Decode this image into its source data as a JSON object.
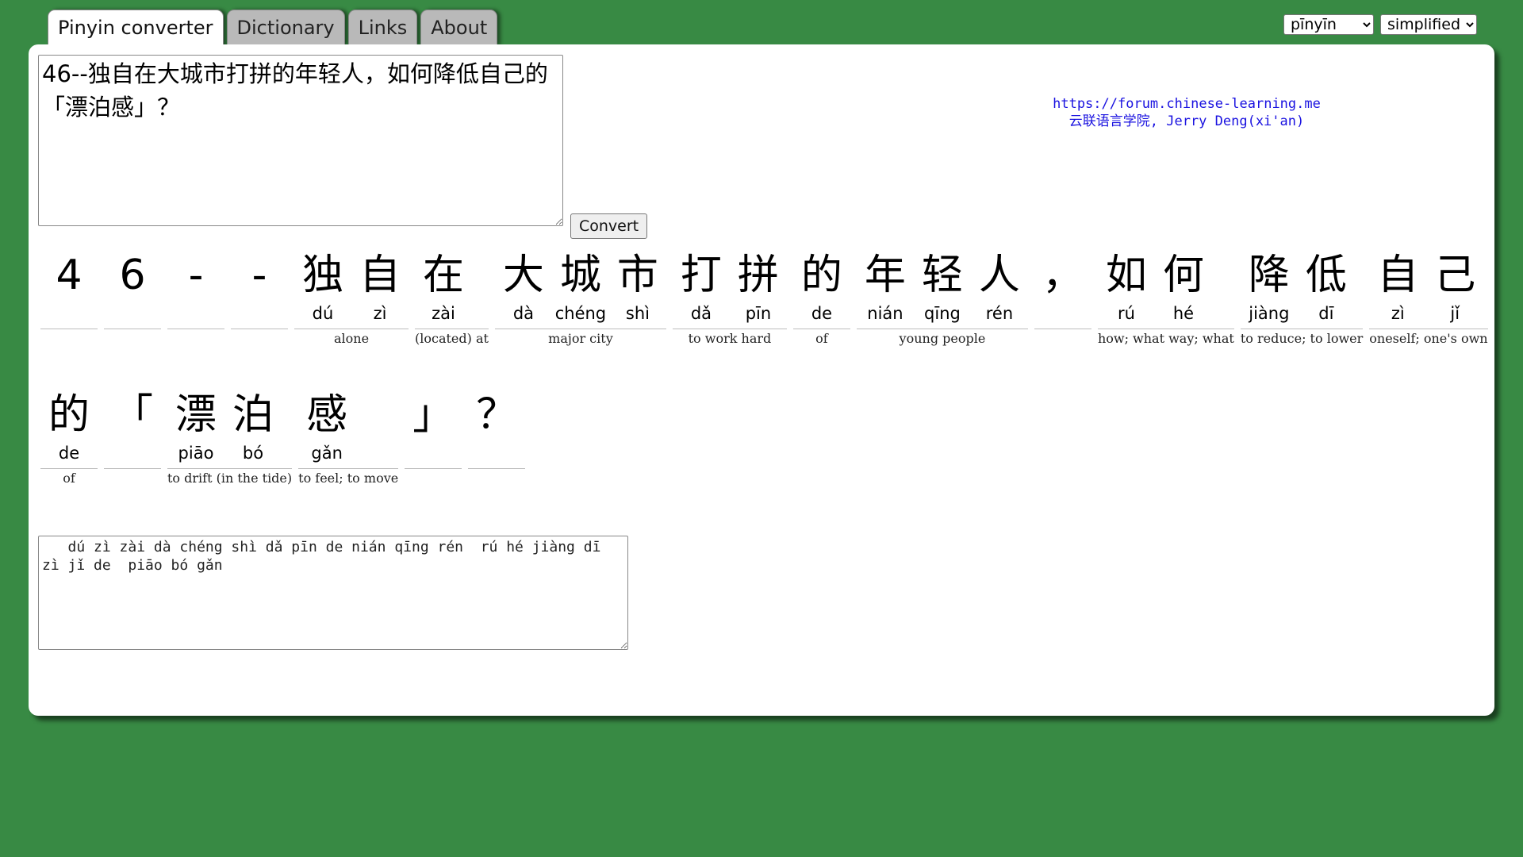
{
  "tabs": [
    {
      "label": "Pinyin converter",
      "active": true
    },
    {
      "label": "Dictionary",
      "active": false
    },
    {
      "label": "Links",
      "active": false
    },
    {
      "label": "About",
      "active": false
    }
  ],
  "selectors": {
    "romanization": "pīnyīn",
    "charset": "simplified"
  },
  "input": {
    "value": "46--独自在大城市打拼的年轻人，如何降低自己的「漂泊感」？"
  },
  "convert_label": "Convert",
  "credits": {
    "url": "https://forum.chinese-learning.me",
    "author": "云联语言学院, Jerry Deng(xi'an)"
  },
  "rows": [
    [
      {
        "chars": [
          {
            "han": "4",
            "py": ""
          }
        ],
        "gloss": ""
      },
      {
        "chars": [
          {
            "han": "6",
            "py": ""
          }
        ],
        "gloss": ""
      },
      {
        "chars": [
          {
            "han": "-",
            "py": ""
          }
        ],
        "gloss": ""
      },
      {
        "chars": [
          {
            "han": "-",
            "py": ""
          }
        ],
        "gloss": ""
      },
      {
        "chars": [
          {
            "han": "独",
            "py": "dú"
          },
          {
            "han": "自",
            "py": "zì"
          }
        ],
        "gloss": "alone"
      },
      {
        "chars": [
          {
            "han": "在",
            "py": "zài"
          }
        ],
        "gloss": "(located) at"
      },
      {
        "chars": [
          {
            "han": "大",
            "py": "dà"
          },
          {
            "han": "城",
            "py": "chéng"
          },
          {
            "han": "市",
            "py": "shì"
          }
        ],
        "gloss": "major city"
      },
      {
        "chars": [
          {
            "han": "打",
            "py": "dǎ"
          },
          {
            "han": "拼",
            "py": "pīn"
          }
        ],
        "gloss": "to work hard"
      },
      {
        "chars": [
          {
            "han": "的",
            "py": "de"
          }
        ],
        "gloss": "of"
      },
      {
        "chars": [
          {
            "han": "年",
            "py": "nián"
          },
          {
            "han": "轻",
            "py": "qīng"
          },
          {
            "han": "人",
            "py": "rén"
          }
        ],
        "gloss": "young people"
      },
      {
        "chars": [
          {
            "han": "，",
            "py": ""
          }
        ],
        "gloss": ""
      },
      {
        "chars": [
          {
            "han": "如",
            "py": "rú"
          },
          {
            "han": "何",
            "py": "hé"
          }
        ],
        "gloss": "how; what way; what"
      },
      {
        "chars": [
          {
            "han": "降",
            "py": "jiàng"
          },
          {
            "han": "低",
            "py": "dī"
          }
        ],
        "gloss": "to reduce; to lower"
      },
      {
        "chars": [
          {
            "han": "自",
            "py": "zì"
          },
          {
            "han": "己",
            "py": "jǐ"
          }
        ],
        "gloss": "oneself; one's own"
      }
    ],
    [
      {
        "chars": [
          {
            "han": "的",
            "py": "de"
          }
        ],
        "gloss": "of"
      },
      {
        "chars": [
          {
            "han": "「",
            "py": ""
          }
        ],
        "gloss": ""
      },
      {
        "chars": [
          {
            "han": "漂",
            "py": "piāo"
          },
          {
            "han": "泊",
            "py": "bó"
          }
        ],
        "gloss": "to drift (in the tide)"
      },
      {
        "chars": [
          {
            "han": "感",
            "py": "gǎn"
          }
        ],
        "gloss": "to feel; to move"
      },
      {
        "chars": [
          {
            "han": "」",
            "py": ""
          }
        ],
        "gloss": ""
      },
      {
        "chars": [
          {
            "han": "？",
            "py": ""
          }
        ],
        "gloss": ""
      }
    ]
  ],
  "output": {
    "value": "   dú zì zài dà chéng shì dǎ pīn de nián qīng rén  rú hé jiàng dī zì jǐ de  piāo bó gǎn"
  }
}
